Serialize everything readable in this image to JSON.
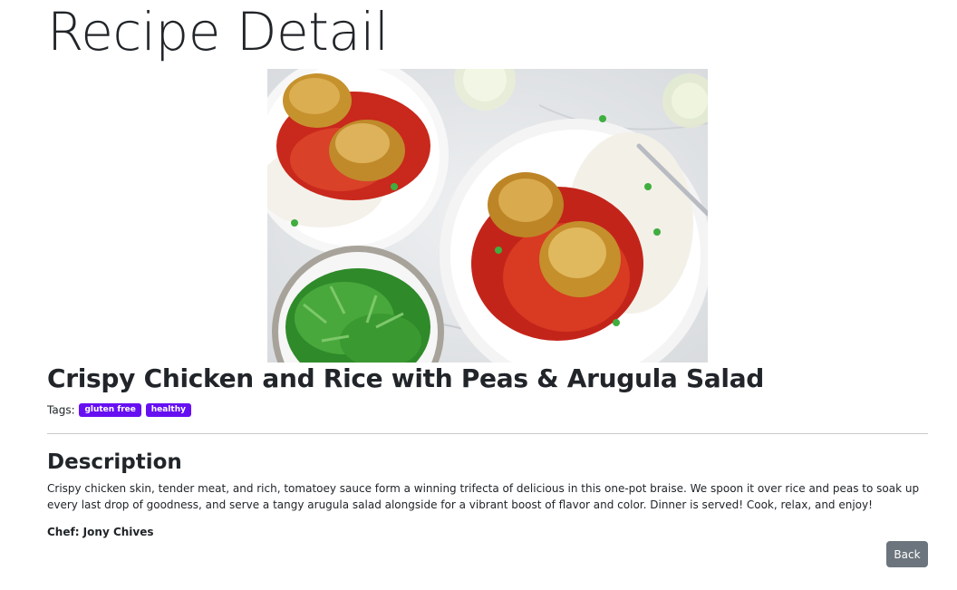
{
  "page": {
    "title": "Recipe Detail"
  },
  "recipe": {
    "title": "Crispy Chicken and Rice with Peas & Arugula Salad",
    "tags_label": "Tags:",
    "tags": [
      "gluten free",
      "healthy"
    ],
    "description_heading": "Description",
    "description": "Crispy chicken skin, tender meat, and rich, tomatoey sauce form a winning trifecta of delicious in this one-pot braise. We spoon it over rice and peas to soak up every last drop of goodness, and serve a tangy arugula salad alongside for a vibrant boost of flavor and color. Dinner is served! Cook, relax, and enjoy!",
    "chef": "Chef: Jony Chives",
    "image_icon": "food-photo"
  },
  "actions": {
    "back_label": "Back"
  },
  "colors": {
    "badge": "#6610f2",
    "back_button": "#6c757d",
    "text": "#212529"
  }
}
